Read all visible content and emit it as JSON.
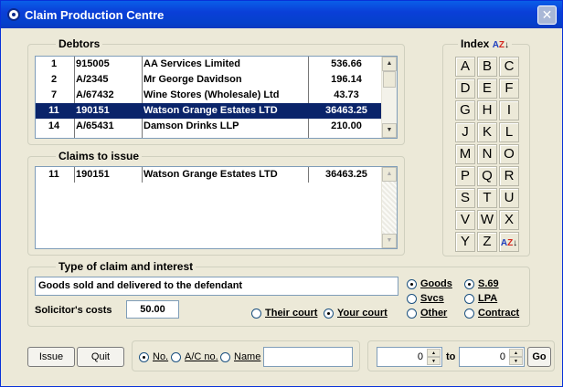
{
  "window": {
    "title": "Claim Production Centre",
    "close_glyph": "✕"
  },
  "debtors": {
    "legend": "Debtors",
    "rows": [
      {
        "no": "1",
        "ref": "915005",
        "name": "AA Services Limited",
        "amount": "536.66"
      },
      {
        "no": "2",
        "ref": "A/2345",
        "name": "Mr George Davidson",
        "amount": "196.14"
      },
      {
        "no": "7",
        "ref": "A/67432",
        "name": "Wine Stores (Wholesale) Ltd",
        "amount": "43.73"
      },
      {
        "no": "11",
        "ref": "190151",
        "name": "Watson Grange Estates LTD",
        "amount": "36463.25",
        "selected": true
      },
      {
        "no": "14",
        "ref": "A/65431",
        "name": "Damson Drinks LLP",
        "amount": "210.00"
      }
    ]
  },
  "claims": {
    "legend": "Claims to issue",
    "rows": [
      {
        "no": "11",
        "ref": "190151",
        "name": "Watson Grange Estates LTD",
        "amount": "36463.25"
      }
    ]
  },
  "index": {
    "legend": "Index",
    "letters": [
      "A",
      "B",
      "C",
      "D",
      "E",
      "F",
      "G",
      "H",
      "I",
      "J",
      "K",
      "L",
      "M",
      "N",
      "O",
      "P",
      "Q",
      "R",
      "S",
      "T",
      "U",
      "V",
      "W",
      "X",
      "Y",
      "Z"
    ],
    "sort_a": "A",
    "sort_z": "Z",
    "sort_arrow": "↓"
  },
  "claim_type": {
    "legend": "Type of claim and interest",
    "description": "Goods sold and delivered to the defendant",
    "solicitor_label": "Solicitor's costs",
    "solicitor_value": "50.00",
    "court_options": [
      {
        "label": "Their court",
        "checked": false
      },
      {
        "label": "Your court",
        "checked": true
      }
    ],
    "type_options": [
      {
        "label": "Goods",
        "checked": true
      },
      {
        "label": "Svcs",
        "checked": false
      },
      {
        "label": "Other",
        "checked": false
      }
    ],
    "interest_options": [
      {
        "label": "S.69",
        "checked": true
      },
      {
        "label": "LPA",
        "checked": false
      },
      {
        "label": "Contract",
        "checked": false
      }
    ]
  },
  "actions": {
    "issue_label": "Issue",
    "quit_label": "Quit"
  },
  "search": {
    "options": [
      {
        "label": "No.",
        "checked": true
      },
      {
        "label": "A/C no.",
        "checked": false
      },
      {
        "label": "Name",
        "checked": false
      }
    ],
    "value": ""
  },
  "range": {
    "from": "0",
    "to_label": "to",
    "to": "0",
    "go_label": "Go"
  }
}
